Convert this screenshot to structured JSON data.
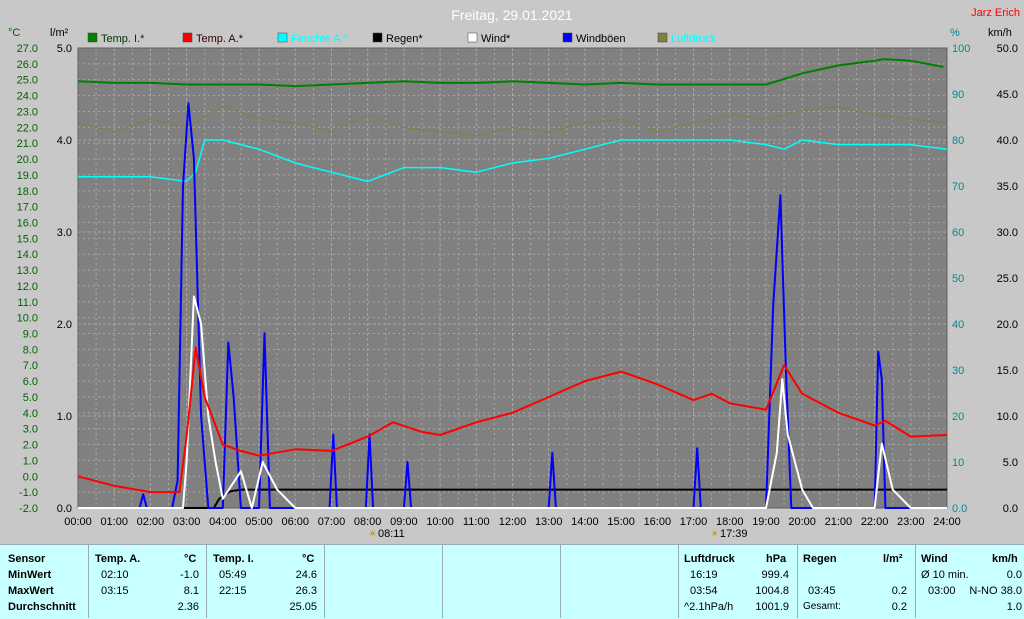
{
  "chart_data": {
    "type": "line",
    "title": "Freitag, 29.01.2021",
    "author": "Jarz Erich",
    "legend": [
      "Temp. I.*",
      "Temp. A.*",
      "Feuchte A.*",
      "Regen*",
      "Wind*",
      "Windböen",
      "Luftdruck"
    ],
    "colors": {
      "Temp. I.*": "#008000",
      "Temp. A.*": "#ff0000",
      "Feuchte A.*": "#00ffff",
      "Regen*": "#000000",
      "Wind*": "#ffffff",
      "Windböen": "#0000ff",
      "Luftdruck": "#808040"
    },
    "axis_units": {
      "temp": "°C",
      "rain": "l/m²",
      "humidity": "%",
      "wind": "km/h"
    },
    "x_ticks": [
      "00:00",
      "01:00",
      "02:00",
      "03:00",
      "04:00",
      "05:00",
      "06:00",
      "07:00",
      "08:00",
      "09:00",
      "10:00",
      "11:00",
      "12:00",
      "13:00",
      "14:00",
      "15:00",
      "16:00",
      "17:00",
      "18:00",
      "19:00",
      "20:00",
      "21:00",
      "22:00",
      "23:00",
      "24:00"
    ],
    "temp_ticks": [
      "27.0",
      "26.0",
      "25.0",
      "24.0",
      "23.0",
      "22.0",
      "21.0",
      "20.0",
      "19.0",
      "18.0",
      "17.0",
      "16.0",
      "15.0",
      "14.0",
      "13.0",
      "12.0",
      "11.0",
      "10.0",
      "9.0",
      "8.0",
      "7.0",
      "6.0",
      "5.0",
      "4.0",
      "3.0",
      "2.0",
      "1.0",
      "0.0",
      "-1.0",
      "-2.0"
    ],
    "rain_ticks": [
      "5.0",
      "4.0",
      "3.0",
      "2.0",
      "1.0",
      "0.0"
    ],
    "humidity_ticks": [
      "100",
      "90",
      "80",
      "70",
      "60",
      "50",
      "40",
      "30",
      "20",
      "10",
      "0.0"
    ],
    "wind_ticks": [
      "50.0",
      "45.0",
      "40.0",
      "35.0",
      "30.0",
      "25.0",
      "20.0",
      "15.0",
      "10.0",
      "5.0",
      "0.0"
    ],
    "sunrise": "08:11",
    "sunset": "17:39",
    "temp_range": [
      -2,
      27
    ],
    "rain_range": [
      0,
      5
    ],
    "humidity_range": [
      0,
      100
    ],
    "wind_range": [
      0,
      50
    ],
    "pressure_range": [
      995,
      1006
    ],
    "series": {
      "temp_inside": [
        [
          0,
          24.9
        ],
        [
          1,
          24.8
        ],
        [
          2,
          24.8
        ],
        [
          3,
          24.7
        ],
        [
          4,
          24.7
        ],
        [
          5,
          24.7
        ],
        [
          6,
          24.6
        ],
        [
          7,
          24.7
        ],
        [
          8,
          24.8
        ],
        [
          9,
          24.9
        ],
        [
          10,
          24.8
        ],
        [
          11,
          24.8
        ],
        [
          12,
          24.9
        ],
        [
          13,
          24.8
        ],
        [
          14,
          24.7
        ],
        [
          15,
          24.8
        ],
        [
          16,
          24.7
        ],
        [
          17,
          24.7
        ],
        [
          18,
          24.7
        ],
        [
          19,
          24.7
        ],
        [
          20,
          25.4
        ],
        [
          21,
          25.9
        ],
        [
          22,
          26.2
        ],
        [
          22.25,
          26.3
        ],
        [
          23,
          26.2
        ],
        [
          23.9,
          25.8
        ]
      ],
      "temp_outside": [
        [
          0,
          0.0
        ],
        [
          1,
          -0.6
        ],
        [
          2,
          -1.0
        ],
        [
          2.17,
          -1.0
        ],
        [
          2.8,
          -1.0
        ],
        [
          3.0,
          2.5
        ],
        [
          3.25,
          8.1
        ],
        [
          3.5,
          5.0
        ],
        [
          4,
          2.0
        ],
        [
          4.5,
          1.6
        ],
        [
          5,
          1.3
        ],
        [
          6,
          1.7
        ],
        [
          7,
          1.6
        ],
        [
          8,
          2.5
        ],
        [
          8.7,
          3.4
        ],
        [
          9.5,
          2.8
        ],
        [
          10,
          2.6
        ],
        [
          11,
          3.4
        ],
        [
          12,
          4.0
        ],
        [
          13,
          5.0
        ],
        [
          14,
          6.0
        ],
        [
          15,
          6.6
        ],
        [
          16,
          5.8
        ],
        [
          17,
          4.8
        ],
        [
          17.5,
          5.2
        ],
        [
          18,
          4.6
        ],
        [
          19,
          4.2
        ],
        [
          19.5,
          7.0
        ],
        [
          20,
          5.2
        ],
        [
          21,
          4.0
        ],
        [
          22,
          3.2
        ],
        [
          22.3,
          3.5
        ],
        [
          23,
          2.5
        ],
        [
          24,
          2.6
        ]
      ],
      "humidity": [
        [
          0,
          72
        ],
        [
          1,
          72
        ],
        [
          2,
          72
        ],
        [
          3,
          71
        ],
        [
          3.25,
          73
        ],
        [
          3.5,
          80
        ],
        [
          4,
          80
        ],
        [
          5,
          78
        ],
        [
          6,
          75
        ],
        [
          7,
          73
        ],
        [
          8,
          71
        ],
        [
          9,
          74
        ],
        [
          10,
          74
        ],
        [
          11,
          73
        ],
        [
          12,
          75
        ],
        [
          13,
          76
        ],
        [
          14,
          78
        ],
        [
          15,
          80
        ],
        [
          16,
          80
        ],
        [
          17,
          80
        ],
        [
          18,
          80
        ],
        [
          19,
          79
        ],
        [
          19.5,
          78
        ],
        [
          20,
          80
        ],
        [
          21,
          79
        ],
        [
          22,
          79
        ],
        [
          23,
          79
        ],
        [
          24,
          78
        ]
      ],
      "rain_cumulative": [
        [
          0,
          0
        ],
        [
          3.75,
          0
        ],
        [
          3.9,
          0.1
        ],
        [
          4.2,
          0.18
        ],
        [
          4.5,
          0.2
        ],
        [
          24,
          0.2
        ]
      ],
      "wind": [
        [
          0,
          0
        ],
        [
          2.9,
          0
        ],
        [
          3.0,
          5
        ],
        [
          3.2,
          23
        ],
        [
          3.4,
          20
        ],
        [
          3.6,
          10
        ],
        [
          3.8,
          5
        ],
        [
          4.0,
          1
        ],
        [
          4.5,
          4
        ],
        [
          4.8,
          0
        ],
        [
          5.1,
          5
        ],
        [
          5.5,
          2
        ],
        [
          6,
          0
        ],
        [
          19.0,
          0
        ],
        [
          19.3,
          6
        ],
        [
          19.45,
          14
        ],
        [
          19.6,
          8
        ],
        [
          20,
          2
        ],
        [
          20.3,
          0
        ],
        [
          22.0,
          0
        ],
        [
          22.2,
          7
        ],
        [
          22.5,
          2
        ],
        [
          23,
          0
        ],
        [
          24,
          0
        ]
      ],
      "wind_gusts": [
        [
          0,
          0
        ],
        [
          1.7,
          0
        ],
        [
          1.8,
          1.5
        ],
        [
          1.9,
          0
        ],
        [
          2.6,
          0
        ],
        [
          2.75,
          3
        ],
        [
          2.9,
          35
        ],
        [
          3.05,
          44
        ],
        [
          3.2,
          38
        ],
        [
          3.4,
          10
        ],
        [
          3.6,
          0
        ],
        [
          4.0,
          0
        ],
        [
          4.15,
          18
        ],
        [
          4.3,
          12
        ],
        [
          4.5,
          0
        ],
        [
          5.0,
          0
        ],
        [
          5.15,
          19
        ],
        [
          5.3,
          0
        ],
        [
          6.95,
          0
        ],
        [
          7.05,
          8
        ],
        [
          7.15,
          0
        ],
        [
          7.95,
          0
        ],
        [
          8.05,
          8
        ],
        [
          8.15,
          0
        ],
        [
          9.0,
          0
        ],
        [
          9.1,
          5
        ],
        [
          9.2,
          0
        ],
        [
          13.0,
          0
        ],
        [
          13.1,
          6
        ],
        [
          13.2,
          0
        ],
        [
          17.0,
          0
        ],
        [
          17.1,
          6.5
        ],
        [
          17.2,
          0
        ],
        [
          19.0,
          0
        ],
        [
          19.2,
          22
        ],
        [
          19.4,
          34
        ],
        [
          19.55,
          15
        ],
        [
          19.7,
          0
        ],
        [
          22.0,
          0
        ],
        [
          22.1,
          17
        ],
        [
          22.2,
          14
        ],
        [
          22.3,
          0
        ],
        [
          24,
          0
        ]
      ],
      "pressure": [
        [
          0,
          1004.2
        ],
        [
          1,
          1004.0
        ],
        [
          2,
          1004.3
        ],
        [
          3,
          1004.1
        ],
        [
          4,
          1004.6
        ],
        [
          5,
          1004.3
        ],
        [
          6,
          1004.2
        ],
        [
          7,
          1004.0
        ],
        [
          8,
          1004.4
        ],
        [
          9,
          1004.1
        ],
        [
          10,
          1004.0
        ],
        [
          11,
          1003.9
        ],
        [
          12,
          1004.1
        ],
        [
          13,
          1004.0
        ],
        [
          14,
          1004.2
        ],
        [
          15,
          1004.3
        ],
        [
          16,
          1004.0
        ],
        [
          17,
          1004.2
        ],
        [
          18,
          1004.4
        ],
        [
          19,
          1004.3
        ],
        [
          20,
          1004.5
        ],
        [
          21,
          1004.6
        ],
        [
          22,
          1004.4
        ],
        [
          23,
          1004.3
        ],
        [
          24,
          1004.2
        ]
      ]
    }
  },
  "stats": {
    "sensor_header": "Sensor",
    "row_labels": [
      "MinWert",
      "MaxWert",
      "Durchschnitt"
    ],
    "temp_a": {
      "label": "Temp. A.",
      "unit": "°C",
      "min_time": "02:10",
      "min": "-1.0",
      "max_time": "03:15",
      "max": "8.1",
      "avg": "2.36"
    },
    "temp_i": {
      "label": "Temp. I.",
      "unit": "°C",
      "min_time": "05:49",
      "min": "24.6",
      "max_time": "22:15",
      "max": "26.3",
      "avg": "25.05"
    },
    "pressure": {
      "label": "Luftdruck",
      "unit": "hPa",
      "min_time": "16:19",
      "min": "999.4",
      "max_time": "03:54",
      "max": "1004.8",
      "trend_label": "^2.1hPa/h",
      "current": "1001.9"
    },
    "rain": {
      "label": "Regen",
      "unit": "l/m²",
      "max_time": "03:45",
      "max": "0.2",
      "total_label": "Gesamt:",
      "total": "0.2"
    },
    "wind": {
      "label": "Wind",
      "unit": "km/h",
      "avg_label": "Ø 10 min.",
      "avg": "0.0",
      "max_time": "03:00",
      "max": "N-NO 38.0",
      "current": "1.0"
    }
  }
}
